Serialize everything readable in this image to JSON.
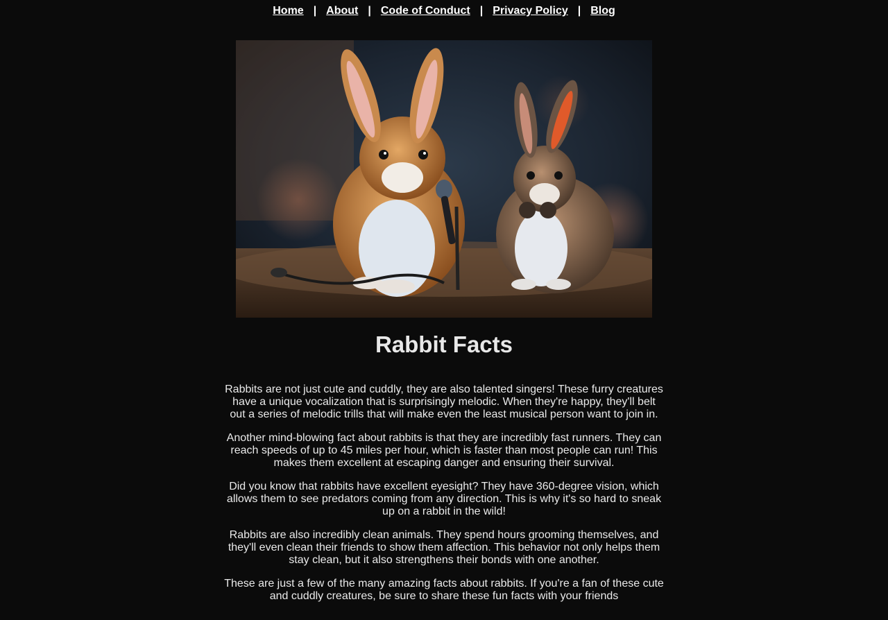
{
  "nav": {
    "links": [
      "Home",
      "About",
      "Code of Conduct",
      "Privacy Policy",
      "Blog"
    ],
    "separator": "|"
  },
  "hero": {
    "icon": "rabbits-singing-image"
  },
  "page": {
    "title": "Rabbit Facts"
  },
  "paragraphs": [
    "Rabbits are not just cute and cuddly, they are also talented singers! These furry creatures have a unique vocalization that is surprisingly melodic. When they're happy, they'll belt out a series of melodic trills that will make even the least musical person want to join in.",
    "Another mind-blowing fact about rabbits is that they are incredibly fast runners. They can reach speeds of up to 45 miles per hour, which is faster than most people can run! This makes them excellent at escaping danger and ensuring their survival.",
    "Did you know that rabbits have excellent eyesight? They have 360-degree vision, which allows them to see predators coming from any direction. This is why it's so hard to sneak up on a rabbit in the wild!",
    "Rabbits are also incredibly clean animals. They spend hours grooming themselves, and they'll even clean their friends to show them affection. This behavior not only helps them stay clean, but it also strengthens their bonds with one another.",
    "These are just a few of the many amazing facts about rabbits. If you're a fan of these cute and cuddly creatures, be sure to share these fun facts with your friends"
  ],
  "colors": {
    "background": "#0b0b0b",
    "text": "#eaeaea",
    "link": "#ffffff"
  }
}
